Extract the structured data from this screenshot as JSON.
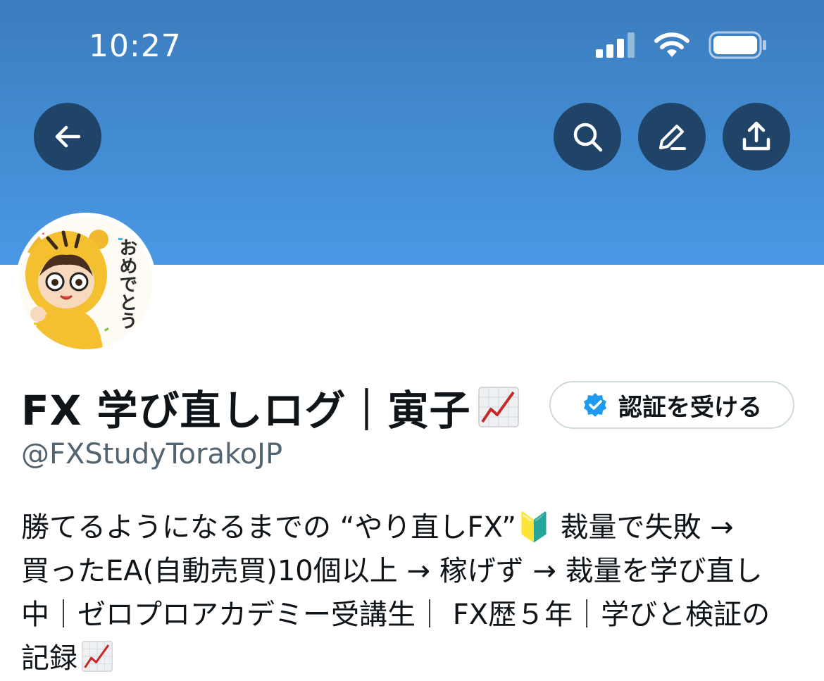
{
  "status_bar": {
    "time": "10:27",
    "icons": [
      "cellular-signal-icon",
      "wifi-icon",
      "battery-icon"
    ]
  },
  "nav": {
    "back": "arrow-left-icon",
    "search": "search-icon",
    "edit": "pencil-icon",
    "share": "share-icon"
  },
  "profile": {
    "display_name": "FX 学び直しログ｜寅子",
    "name_emoji": "chart-increasing-icon",
    "verify_label": "認証を受ける",
    "handle": "@FXStudyTorakoJP",
    "bio_lines": [
      "勝てるようになるまでの “やり直しFX”🔰 裁量で失敗 →",
      "買ったEA(自動売買)10個以上 → 稼げず → 裁量を学び直し",
      "中｜ゼロプロアカデミー受講生｜ FX歴５年｜学びと検証の",
      "記録"
    ],
    "avatar_text": "おめでとう"
  },
  "colors": {
    "banner_top": "#3b7dbe",
    "banner_bottom": "#4a98e4",
    "nav_button": "#1f4468",
    "verified_blue": "#1d9bf0",
    "handle_gray": "#536471"
  }
}
